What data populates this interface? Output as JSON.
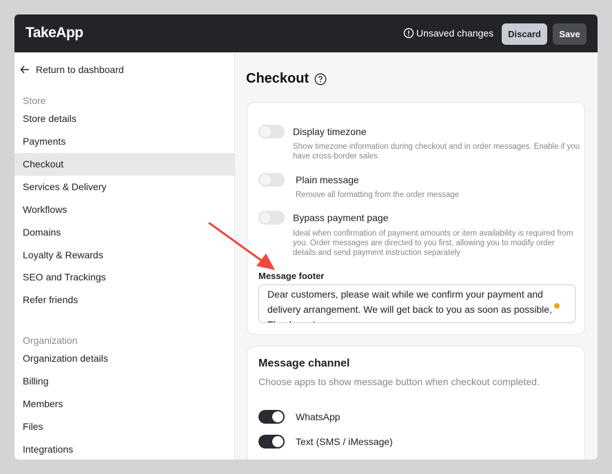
{
  "app": {
    "logo": "TakeApp"
  },
  "header": {
    "unsaved_label": "Unsaved changes",
    "discard_label": "Discard",
    "save_label": "Save"
  },
  "sidebar": {
    "back_label": "Return to dashboard",
    "store_group": "Store",
    "store_items": [
      "Store details",
      "Payments",
      "Checkout",
      "Services & Delivery",
      "Workflows",
      "Domains",
      "Loyalty & Rewards",
      "SEO and Trackings",
      "Refer friends"
    ],
    "active_item": "Checkout",
    "org_group": "Organization",
    "org_items": [
      "Organization details",
      "Billing",
      "Members",
      "Files",
      "Integrations"
    ]
  },
  "main": {
    "title": "Checkout",
    "options": [
      {
        "label": "Display timezone",
        "enabled": false,
        "description": "Show timezone information during checkout and in order messages. Enable if you have cross-border sales."
      },
      {
        "label": "Plain message",
        "enabled": false,
        "description": "Remove all formatting from the order message"
      },
      {
        "label": "Bypass payment page",
        "enabled": false,
        "description": "Ideal when confirmation of payment amounts or item availability is required from you. Order messages are directed to you first, allowing you to modify order details and send payment instruction separately"
      }
    ],
    "message_footer": {
      "label": "Message footer",
      "value": "Dear customers, please wait while we confirm your payment and delivery arrangement. We will get back to you as soon as possible, Thank you!"
    },
    "message_channel": {
      "title": "Message channel",
      "subtitle": "Choose apps to show message button when checkout completed.",
      "channels": [
        {
          "label": "WhatsApp",
          "enabled": true
        },
        {
          "label": "Text (SMS / iMessage)",
          "enabled": true
        }
      ]
    }
  },
  "colors": {
    "topbar": "#222428",
    "annotation_arrow": "#f0483e",
    "unsaved_dot": "#f4a21a",
    "active_nav": "#e8e8e8"
  }
}
